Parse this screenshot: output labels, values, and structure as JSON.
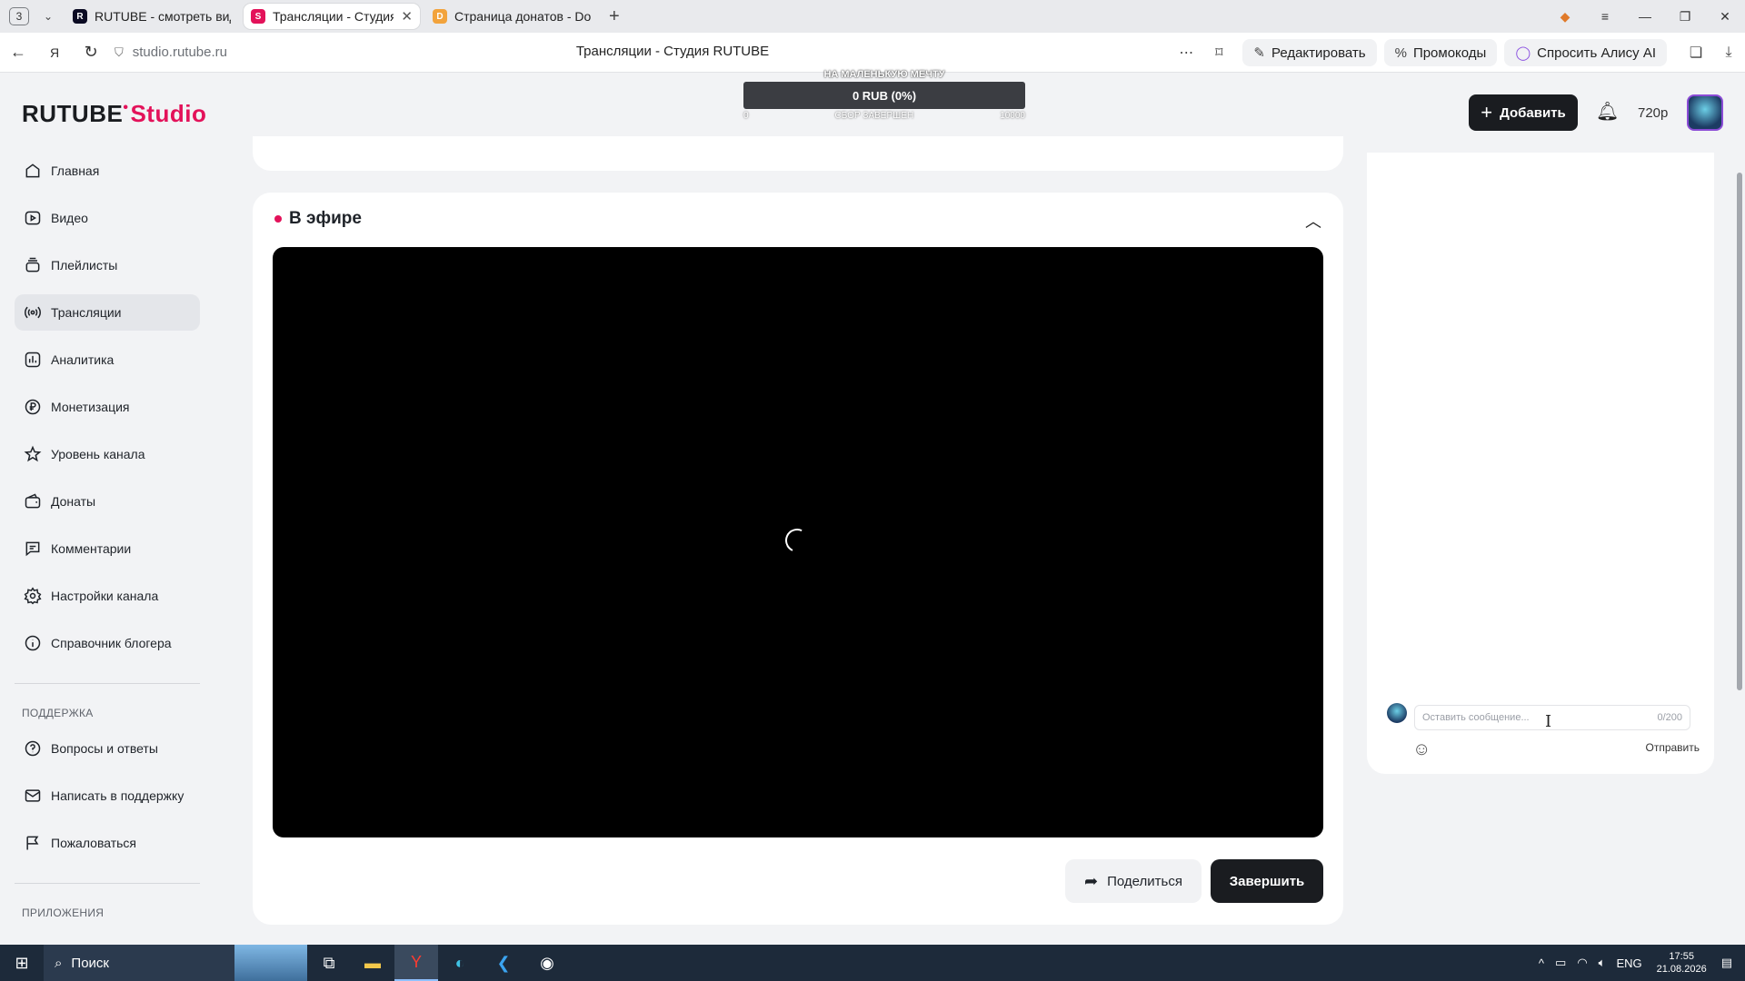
{
  "browser": {
    "tab_count": "3",
    "tabs": [
      {
        "title": "RUTUBE - смотреть видео",
        "active": false,
        "favicon_color": "#0b0b23"
      },
      {
        "title": "Трансляции - Студия RUTUBE",
        "active": true,
        "favicon_color": "#e3125a"
      },
      {
        "title": "Страница донатов - Donat",
        "active": false,
        "favicon_color": "#f2a33c"
      }
    ],
    "url": "studio.rutube.ru",
    "page_title": "Трансляции - Студия RUTUBE",
    "toolbar": {
      "edit_label": "Редактировать",
      "promo_label": "Промокоды",
      "alice_label": "Спросить Алису AI"
    }
  },
  "header": {
    "logo_text": "RUTUBE",
    "logo_studio": "Studio",
    "add_label": "Добавить",
    "quality": "720p",
    "donation": {
      "goal": "НА МАЛЕНЬКУЮ МЕЧТУ",
      "amount": "0 RUB (0%)",
      "left": "0",
      "status": "СБОР ЗАВЕРШЕН",
      "right": "10000"
    }
  },
  "sidebar": {
    "items": [
      {
        "label": "Главная",
        "icon": "home-icon"
      },
      {
        "label": "Видео",
        "icon": "video-icon"
      },
      {
        "label": "Плейлисты",
        "icon": "playlist-icon"
      },
      {
        "label": "Трансляции",
        "icon": "broadcast-icon",
        "active": true
      },
      {
        "label": "Аналитика",
        "icon": "analytics-icon"
      },
      {
        "label": "Монетизация",
        "icon": "ruble-icon"
      },
      {
        "label": "Уровень канала",
        "icon": "star-icon"
      },
      {
        "label": "Донаты",
        "icon": "wallet-icon"
      },
      {
        "label": "Комментарии",
        "icon": "comment-icon"
      },
      {
        "label": "Настройки канала",
        "icon": "gear-icon"
      },
      {
        "label": "Справочник блогера",
        "icon": "info-icon"
      }
    ],
    "support_title": "ПОДДЕРЖКА",
    "support_items": [
      {
        "label": "Вопросы и ответы",
        "icon": "question-icon"
      },
      {
        "label": "Написать в поддержку",
        "icon": "mail-icon"
      },
      {
        "label": "Пожаловаться",
        "icon": "flag-icon"
      }
    ],
    "apps_title": "ПРИЛОЖЕНИЯ"
  },
  "live": {
    "title": "В эфире",
    "share_label": "Поделиться",
    "finish_label": "Завершить"
  },
  "chat": {
    "placeholder": "Оставить сообщение...",
    "counter": "0/200",
    "send_label": "Отправить"
  },
  "taskbar": {
    "search_label": "Поиск",
    "language": "ENG",
    "time": "17:55",
    "date": "21.08.2026"
  },
  "colors": {
    "accent": "#e3125a",
    "dark_button": "#1a1c20",
    "page_bg": "#f2f3f5"
  }
}
